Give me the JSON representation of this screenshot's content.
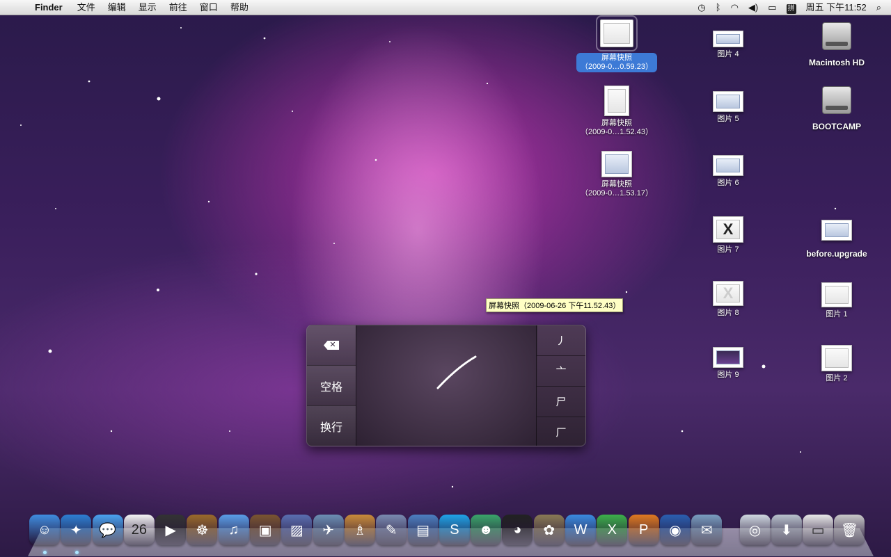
{
  "menubar": {
    "app_name": "Finder",
    "menus": [
      "文件",
      "编辑",
      "显示",
      "前往",
      "窗口",
      "帮助"
    ],
    "clock": "周五 下午11:52",
    "ime_indicator": "拼"
  },
  "desktop": {
    "screenshots": [
      {
        "line1": "屏幕快照",
        "line2": "（2009-0…0.59.23）",
        "selected": true
      },
      {
        "line1": "屏幕快照",
        "line2": "（2009-0…1.52.43）",
        "selected": false
      },
      {
        "line1": "屏幕快照",
        "line2": "（2009-0…1.53.17）",
        "selected": false
      }
    ],
    "images_col": [
      "图片 4",
      "图片 5",
      "图片 6",
      "图片 7",
      "图片 8",
      "图片 9"
    ],
    "right_col": {
      "drive1": "Macintosh HD",
      "drive2": "BOOTCAMP",
      "folder": "before.upgrade",
      "image1": "图片 1",
      "image2": "图片 2"
    }
  },
  "tooltip": "屏幕快照（2009-06-26 下午11.52.43）",
  "handwriting": {
    "space_label": "空格",
    "return_label": "换行",
    "delete_icon": "delete-backward-icon",
    "candidates": [
      "丿",
      "亠",
      "尸",
      "厂"
    ]
  },
  "dock": {
    "apps": [
      {
        "icon": "finder-icon",
        "glyph": "☺",
        "color": "#3f8de0"
      },
      {
        "icon": "safari-icon",
        "glyph": "✦",
        "color": "#2d7fd3"
      },
      {
        "icon": "ichat-icon",
        "glyph": "💬",
        "color": "#4aa3f0"
      },
      {
        "icon": "ical-icon",
        "glyph": "26",
        "color": "#f4f4f4"
      },
      {
        "icon": "front-row-icon",
        "glyph": "▶",
        "color": "#333333"
      },
      {
        "icon": "cog-icon",
        "glyph": "☸",
        "color": "#9a6a2a"
      },
      {
        "icon": "itunes-icon",
        "glyph": "♫",
        "color": "#5a9ee8"
      },
      {
        "icon": "iphoto-icon",
        "glyph": "▣",
        "color": "#7a5530"
      },
      {
        "icon": "vmware-icon",
        "glyph": "▨",
        "color": "#5a6fb0"
      },
      {
        "icon": "network-utility-icon",
        "glyph": "✈",
        "color": "#6c8fb3"
      },
      {
        "icon": "keynote-icon",
        "glyph": "♗",
        "color": "#c98b3a"
      },
      {
        "icon": "script-editor-icon",
        "glyph": "✎",
        "color": "#7a8ab0"
      },
      {
        "icon": "grapher-icon",
        "glyph": "▤",
        "color": "#4c7fc0"
      },
      {
        "icon": "skype-icon",
        "glyph": "S",
        "color": "#1fa3e8"
      },
      {
        "icon": "msn-messenger-icon",
        "glyph": "☻",
        "color": "#3aa56a"
      },
      {
        "icon": "qq-icon",
        "glyph": "◕",
        "color": "#222222"
      },
      {
        "icon": "gimp-icon",
        "glyph": "✿",
        "color": "#8a7a55"
      },
      {
        "icon": "word-icon",
        "glyph": "W",
        "color": "#3a8be0"
      },
      {
        "icon": "excel-icon",
        "glyph": "X",
        "color": "#3cb04a"
      },
      {
        "icon": "powerpoint-icon",
        "glyph": "P",
        "color": "#e07a20"
      },
      {
        "icon": "google-earth-icon",
        "glyph": "◉",
        "color": "#2a5fb0"
      },
      {
        "icon": "preview-icon",
        "glyph": "✉",
        "color": "#7a9ec0"
      },
      {
        "icon": "applications-folder-icon",
        "glyph": "◎",
        "color": "#cfd8e0"
      },
      {
        "icon": "downloads-stack-icon",
        "glyph": "⬇",
        "color": "#b8c2cc"
      },
      {
        "icon": "documents-stack-icon",
        "glyph": "▭",
        "color": "#e8e8e8"
      },
      {
        "icon": "trash-icon",
        "glyph": "🗑",
        "color": "#c8c8c8"
      }
    ]
  }
}
